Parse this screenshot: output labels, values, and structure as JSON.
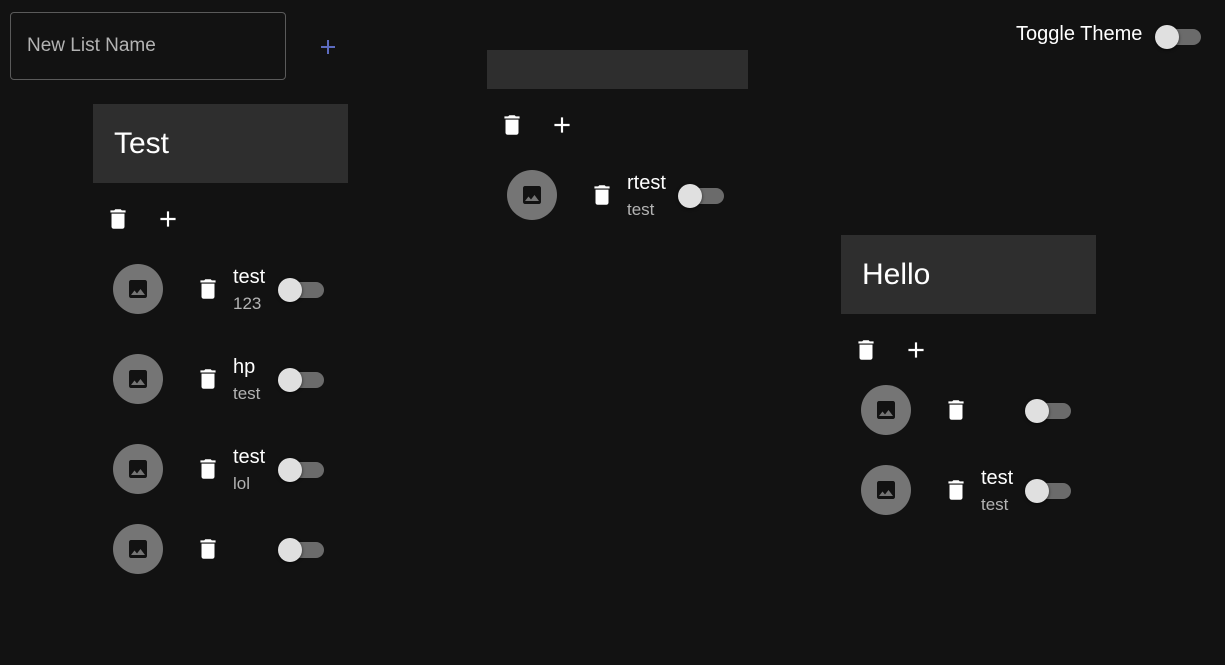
{
  "new_list": {
    "placeholder": "New List Name",
    "value": ""
  },
  "theme": {
    "label": "Toggle Theme",
    "dark_mode": false
  },
  "colors": {
    "accent": "#5c6bc0",
    "background": "#121212",
    "card": "#2e2e2e",
    "avatar": "#757575",
    "switch_thumb": "#e0e0e0",
    "switch_track": "#6b6b6b"
  },
  "icons": {
    "delete": "trash-icon",
    "add": "plus-icon",
    "avatar": "image-icon"
  },
  "lists": [
    {
      "title": "Test",
      "items": [
        {
          "primary": "test",
          "secondary": "123",
          "checked": false
        },
        {
          "primary": "hp",
          "secondary": "test",
          "checked": false
        },
        {
          "primary": "test",
          "secondary": "lol",
          "checked": false
        },
        {
          "primary": "",
          "secondary": "",
          "checked": false
        }
      ]
    },
    {
      "title": "",
      "items": [
        {
          "primary": "rtest",
          "secondary": "test",
          "checked": false
        }
      ]
    },
    {
      "title": "Hello",
      "items": [
        {
          "primary": "",
          "secondary": "",
          "checked": false
        },
        {
          "primary": "test",
          "secondary": "test",
          "checked": false
        }
      ]
    }
  ]
}
